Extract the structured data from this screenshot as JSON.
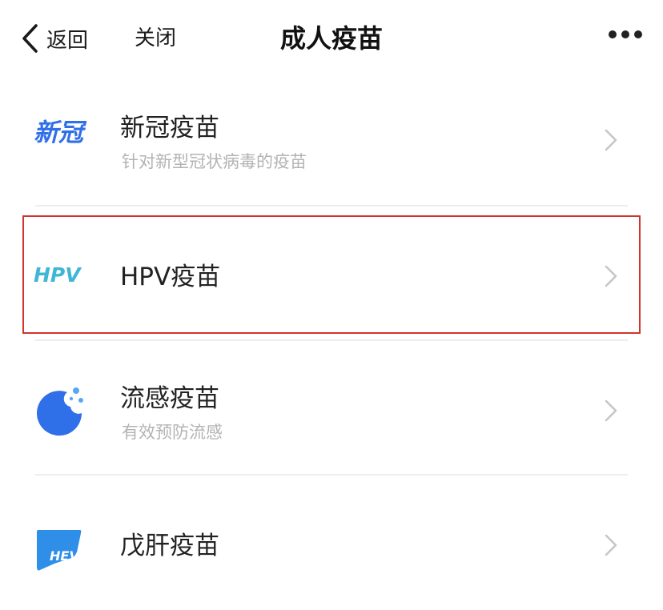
{
  "header": {
    "back_label": "返回",
    "close_label": "关闭",
    "title": "成人疫苗"
  },
  "colors": {
    "accent_blue": "#2f6fe8",
    "hpv_teal": "#3fb6d6",
    "highlight_red": "#d0342c",
    "subtitle_gray": "#b3b3b3"
  },
  "items": [
    {
      "icon": "covid-logo-icon",
      "icon_text": "新冠",
      "name": "新冠疫苗",
      "desc": "针对新型冠状病毒的疫苗"
    },
    {
      "icon": "hpv-logo-icon",
      "icon_text": "HPV",
      "name": "HPV疫苗",
      "desc": ""
    },
    {
      "icon": "flu-icon",
      "icon_text": "",
      "name": "流感疫苗",
      "desc": "有效预防流感"
    },
    {
      "icon": "hev-liver-icon",
      "icon_text": "HEV",
      "name": "戊肝疫苗",
      "desc": ""
    }
  ]
}
